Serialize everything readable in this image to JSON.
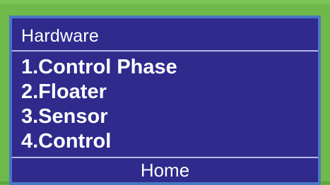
{
  "screen": {
    "title": "Hardware",
    "menu": [
      {
        "label": "1.Control Phase"
      },
      {
        "label": "2.Floater"
      },
      {
        "label": "3.Sensor"
      },
      {
        "label": "4.Control"
      }
    ],
    "footer": {
      "home_label": "Home"
    }
  },
  "colors": {
    "bezel": "#6fb84a",
    "frame": "#4a77c4",
    "lcd_background": "#2f2a8c",
    "text": "#ffffff"
  }
}
